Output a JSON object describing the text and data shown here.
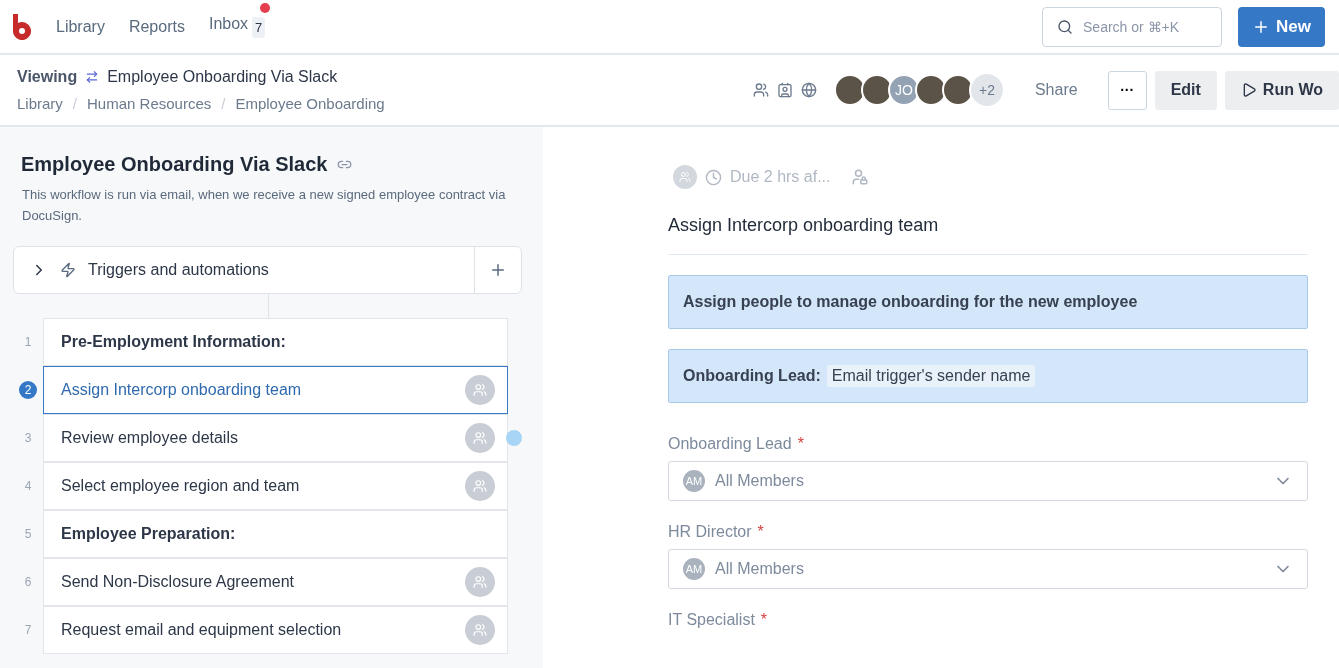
{
  "nav": {
    "items": [
      {
        "label": "Library"
      },
      {
        "label": "Reports"
      },
      {
        "label": "Inbox",
        "badge": "7",
        "unread": true
      }
    ],
    "search": {
      "placeholder": "Search or ⌘+K"
    },
    "new_button": "New"
  },
  "header": {
    "mode": "Viewing",
    "title": "Employee Onboarding Via Slack",
    "breadcrumbs": [
      "Library",
      "/",
      "Human Resources",
      "/",
      "Employee Onboarding"
    ],
    "avatars": [
      {
        "kind": "photo"
      },
      {
        "kind": "photo"
      },
      {
        "kind": "initials",
        "text": "JO"
      },
      {
        "kind": "photo"
      },
      {
        "kind": "photo"
      },
      {
        "kind": "more",
        "text": "+2"
      }
    ],
    "share": "Share",
    "more": "···",
    "edit": "Edit",
    "run": "Run Wo"
  },
  "workflow": {
    "title": "Employee Onboarding Via Slack",
    "description": "This workflow is run via email, when we receive a new signed employee contract via DocuSign.",
    "triggers": "Triggers and automations",
    "steps": [
      {
        "number": "1",
        "label": "Pre-Employment Information:",
        "kind": "heading",
        "selected": false
      },
      {
        "number": "2",
        "label": "Assign Intercorp onboarding team",
        "kind": "task",
        "selected": true
      },
      {
        "number": "3",
        "label": "Review employee details",
        "kind": "task",
        "selected": false
      },
      {
        "number": "4",
        "label": "Select employee region and team",
        "kind": "task",
        "selected": false
      },
      {
        "number": "5",
        "label": "Employee Preparation:",
        "kind": "heading",
        "selected": false
      },
      {
        "number": "6",
        "label": "Send Non-Disclosure Agreement",
        "kind": "task",
        "selected": false
      },
      {
        "number": "7",
        "label": "Request email and equipment selection",
        "kind": "task",
        "selected": false
      }
    ]
  },
  "task": {
    "due": "Due 2 hrs af...",
    "title": "Assign Intercorp onboarding team",
    "instruction": "Assign people to manage onboarding for the new employee",
    "assignment": {
      "label": "Onboarding Lead:",
      "value": "Email trigger's sender name"
    },
    "fields": [
      {
        "label": "Onboarding Lead",
        "required_mark": "*",
        "initials": "AM",
        "value": "All Members"
      },
      {
        "label": "HR Director",
        "required_mark": "*",
        "initials": "AM",
        "value": "All Members"
      },
      {
        "label": "IT Specialist",
        "required_mark": "*"
      }
    ]
  }
}
